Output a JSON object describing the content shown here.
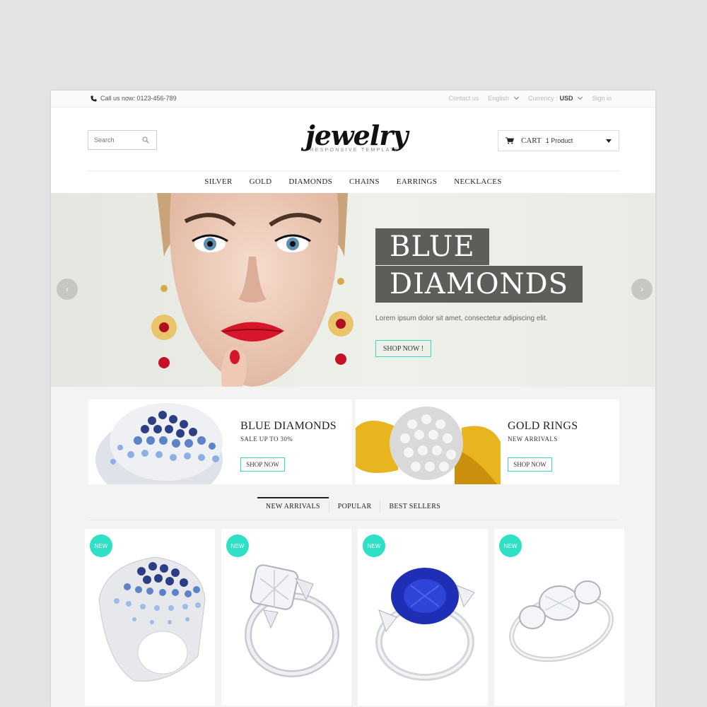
{
  "topbar": {
    "call": "Call us now: 0123-456-789",
    "contact": "Contact us",
    "language": "English",
    "currency_label": "Currency :",
    "currency_value": "USD",
    "signin": "Sign in"
  },
  "header": {
    "search_placeholder": "Search",
    "logo": "jewelry",
    "logo_tagline": "RESPONSIVE TEMPLATE",
    "cart_label": "CART",
    "cart_count": "1 Product"
  },
  "nav": [
    "SILVER",
    "GOLD",
    "DIAMONDS",
    "CHAINS",
    "EARRINGS",
    "NECKLACES"
  ],
  "hero": {
    "title_line1": "BLUE",
    "title_line2": "DIAMONDS",
    "lead": "Lorem ipsum dolor sit amet, consectetur adipiscing elit.",
    "button": "SHOP NOW !",
    "prev": "‹",
    "next": "›"
  },
  "promos": [
    {
      "title": "BLUE DIAMONDS",
      "subtitle": "SALE UP TO 30%",
      "button": "SHOP NOW"
    },
    {
      "title": "GOLD RINGS",
      "subtitle": "NEW ARRIVALS",
      "button": "SHOP NOW"
    }
  ],
  "tabs": [
    "NEW ARRIVALS",
    "POPULAR",
    "BEST SELLERS"
  ],
  "products": [
    {
      "badge": "NEW",
      "icon": "sapphire-dome-ring-icon"
    },
    {
      "badge": "NEW",
      "icon": "diamond-solitaire-ring-icon"
    },
    {
      "badge": "NEW",
      "icon": "blue-sapphire-ring-icon"
    },
    {
      "badge": "NEW",
      "icon": "three-stone-diamond-ring-icon"
    }
  ],
  "colors": {
    "accent": "#2ee0c4",
    "title_box": "#5d5e5a"
  }
}
